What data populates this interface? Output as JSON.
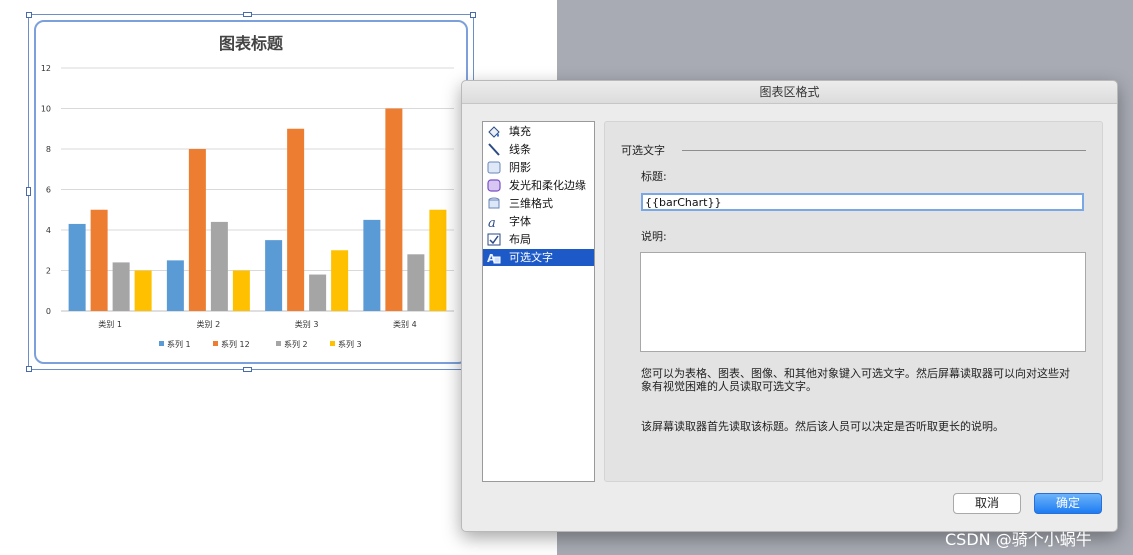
{
  "chart": {
    "title": "图表标题",
    "chart_data": {
      "type": "bar",
      "title": "图表标题",
      "categories": [
        "类别 1",
        "类别 2",
        "类别 3",
        "类别 4"
      ],
      "ylim": [
        0,
        12
      ],
      "yticks": [
        "0",
        "2",
        "4",
        "6",
        "8",
        "10",
        "12"
      ],
      "grid": true,
      "legend_placement": "bottom",
      "series": [
        {
          "name": "系列 1",
          "color": "#5b9bd5",
          "values": [
            4.3,
            2.5,
            3.5,
            4.5
          ]
        },
        {
          "name": "系列 12",
          "color": "#ed7d31",
          "values": [
            5,
            8,
            9,
            10
          ]
        },
        {
          "name": "系列 2",
          "color": "#a5a5a5",
          "values": [
            2.4,
            4.4,
            1.8,
            2.8
          ]
        },
        {
          "name": "系列 3",
          "color": "#ffc000",
          "values": [
            2,
            2,
            3,
            5
          ]
        }
      ]
    }
  },
  "dialog": {
    "title": "图表区格式",
    "categories": [
      {
        "label": "填充",
        "icon": "fill-bucket-icon"
      },
      {
        "label": "线条",
        "icon": "line-icon"
      },
      {
        "label": "阴影",
        "icon": "shadow-icon"
      },
      {
        "label": "发光和柔化边缘",
        "icon": "glow-icon"
      },
      {
        "label": "三维格式",
        "icon": "3d-format-icon"
      },
      {
        "label": "字体",
        "icon": "font-icon"
      },
      {
        "label": "布局",
        "icon": "layout-icon"
      },
      {
        "label": "可选文字",
        "icon": "alt-text-icon"
      }
    ],
    "selected_index": 7,
    "section_title": "可选文字",
    "title_label": "标题:",
    "title_value": "{{barChart}}",
    "description_label": "说明:",
    "description_value": "",
    "info_line1": "您可以为表格、图表、图像、和其他对象键入可选文字。然后屏幕读取器可以向对这些对",
    "info_line2": "象有视觉困难的人员读取可选文字。",
    "info_line3": "该屏幕读取器首先读取该标题。然后该人员可以决定是否听取更长的说明。",
    "cancel_label": "取消",
    "ok_label": "确定"
  },
  "watermark": "CSDN @骑个小蜗牛"
}
